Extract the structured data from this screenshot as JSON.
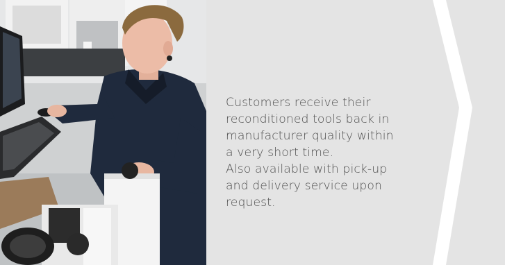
{
  "content": {
    "description_lines": [
      "Customers receive their",
      "reconditioned tools back in",
      "manufacturer quality within",
      "a very short time.",
      "Also available with pick-up",
      "and delivery service upon",
      "request."
    ]
  },
  "photo": {
    "subject": "technician operating tool inspection machine at computer workstation"
  },
  "colors": {
    "panel_background": "#e4e4e4",
    "arrow_separator": "#ffffff",
    "text": "#4f4f4f"
  }
}
